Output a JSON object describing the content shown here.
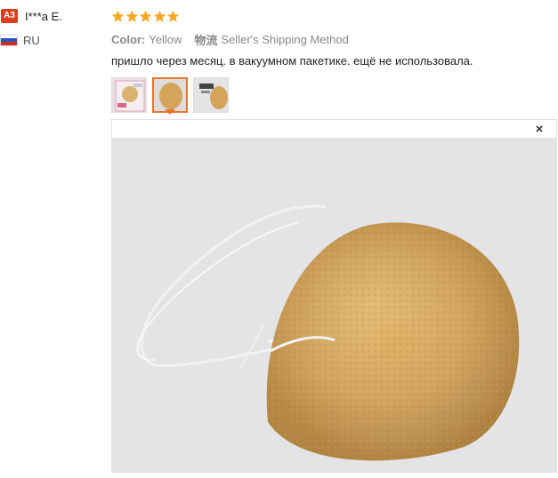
{
  "user": {
    "level_badge": "A3",
    "name": "I***a E.",
    "country_code": "RU"
  },
  "review": {
    "rating": 5,
    "color_label": "Color:",
    "color_value": "Yellow",
    "shipping_label": "物流",
    "shipping_value": "Seller's Shipping Method",
    "text": "пришло через месяц. в вакуумном пакетике. ещё не использовала."
  },
  "viewer": {
    "close_symbol": "×"
  },
  "colors": {
    "star": "#f5a623",
    "badge": "#d8401c",
    "active_thumb_border": "#e8732a",
    "sponge": "#d8a85a"
  }
}
